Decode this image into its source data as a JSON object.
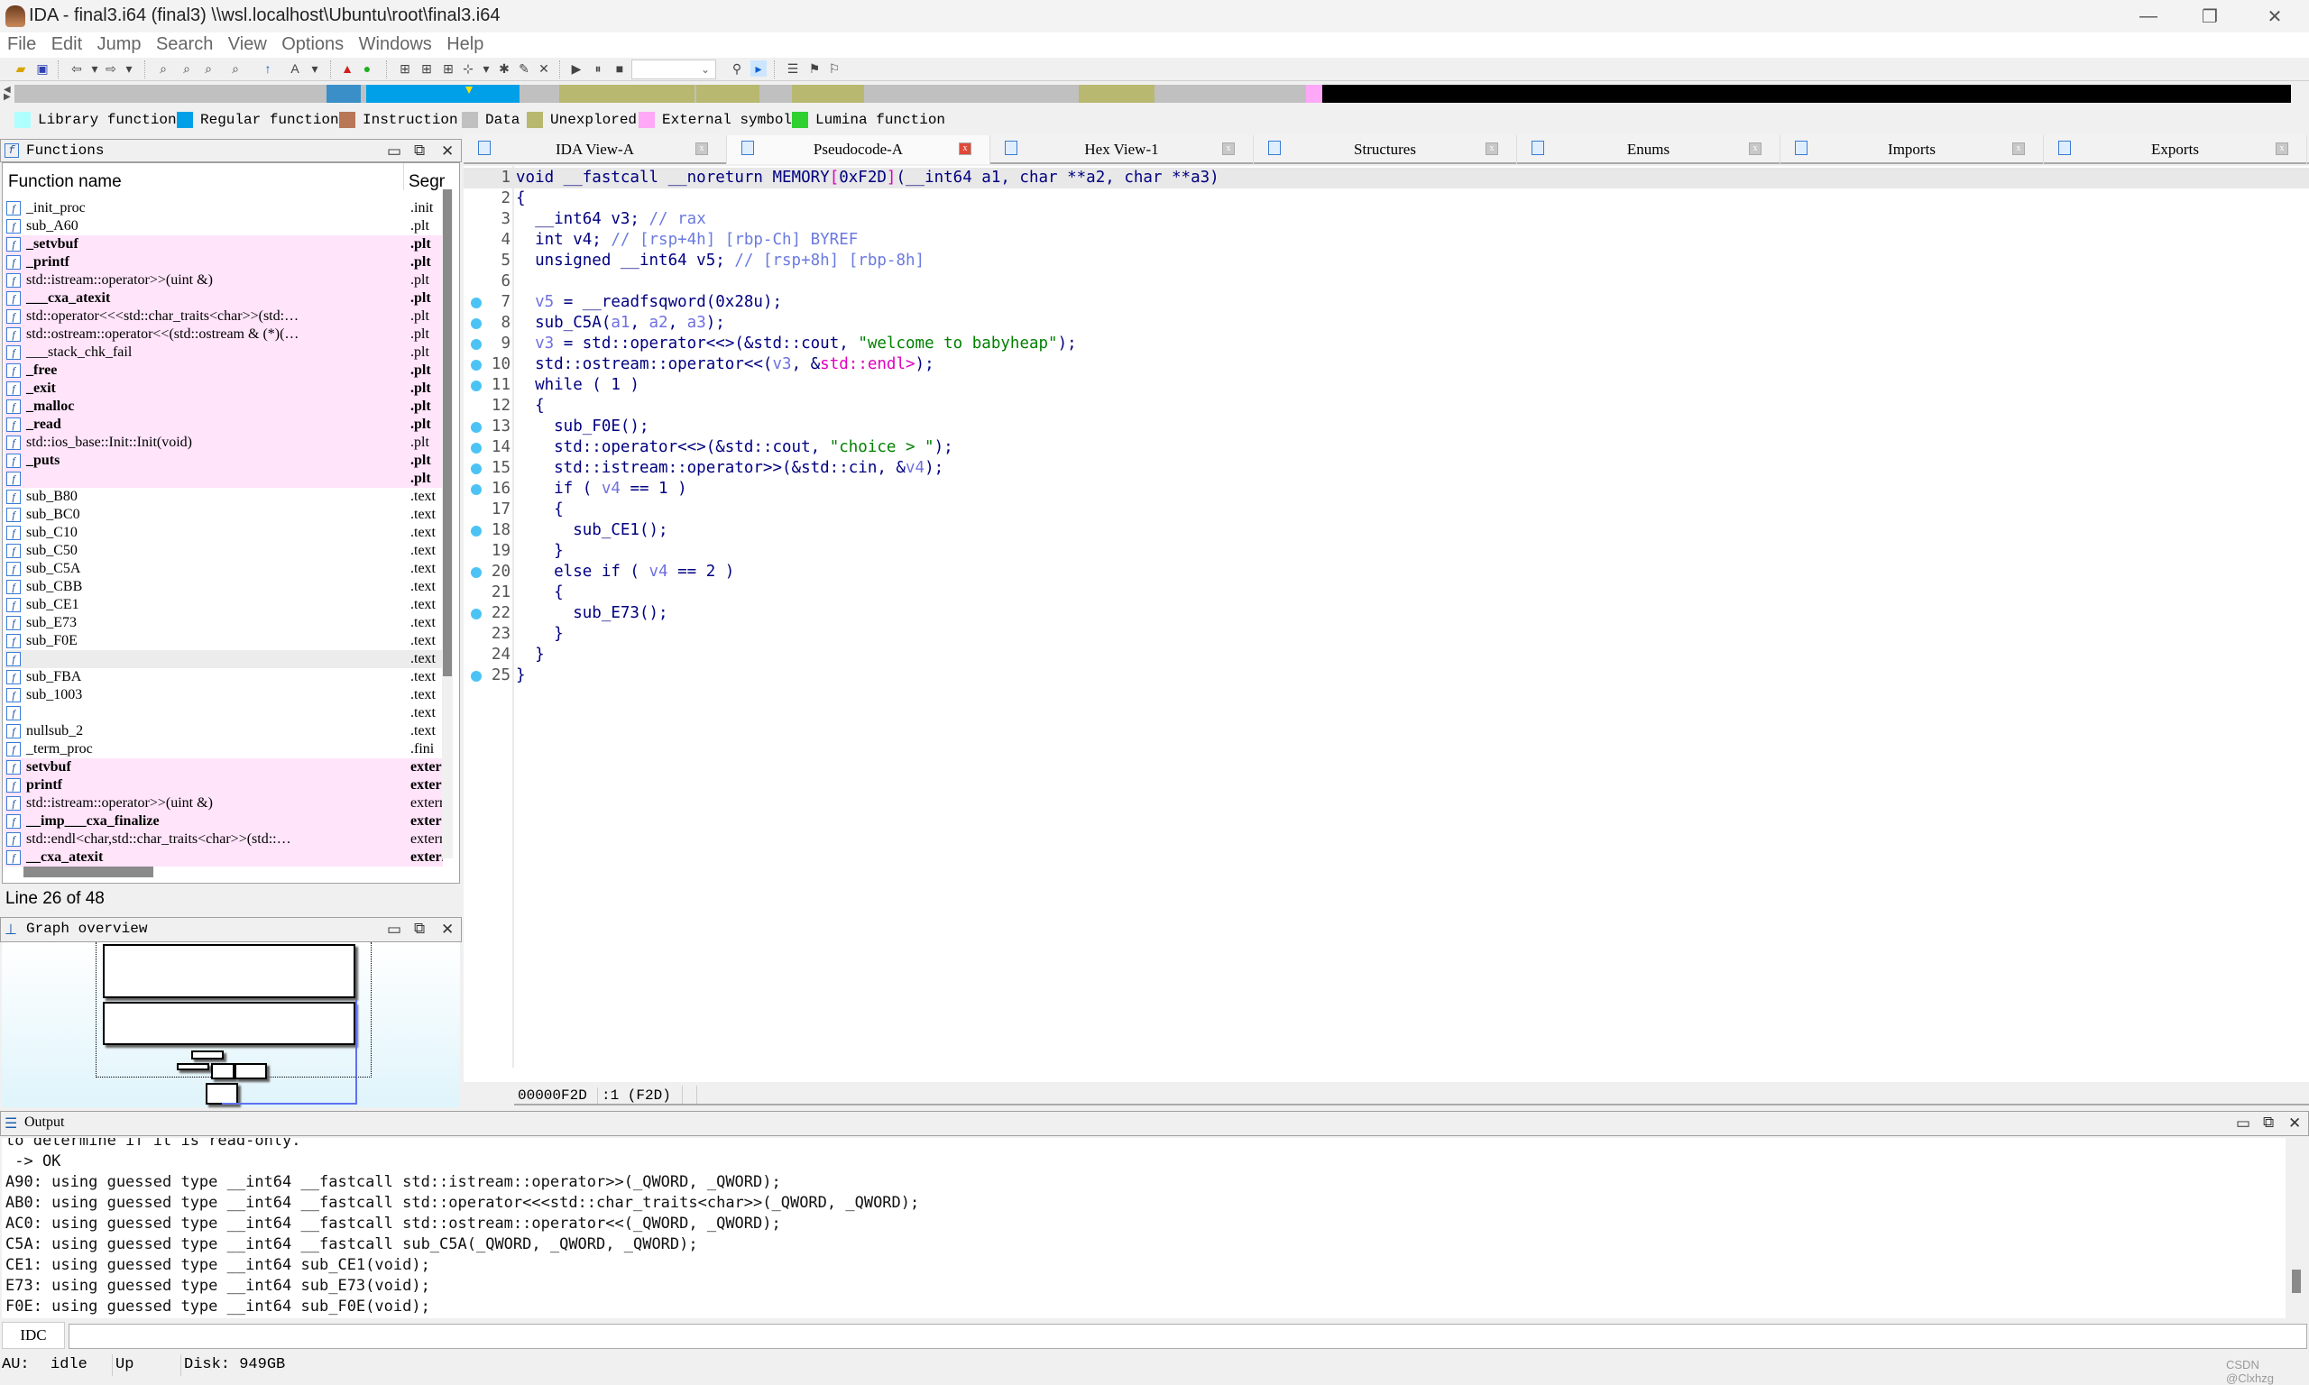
{
  "window": {
    "title": "IDA - final3.i64 (final3) \\\\wsl.localhost\\Ubuntu\\root\\final3.i64"
  },
  "menu": [
    "File",
    "Edit",
    "Jump",
    "Search",
    "View",
    "Options",
    "Windows",
    "Help"
  ],
  "legend": [
    {
      "label": "Library function",
      "color": "#b0ffff"
    },
    {
      "label": "Regular function",
      "color": "#00a0e8"
    },
    {
      "label": "Instruction",
      "color": "#b87858"
    },
    {
      "label": "Data",
      "color": "#c0c0c0"
    },
    {
      "label": "Unexplored",
      "color": "#b8b870"
    },
    {
      "label": "External symbol",
      "color": "#ffa8f8"
    },
    {
      "label": "Lumina function",
      "color": "#30d030"
    }
  ],
  "functions_panel": {
    "title": "Functions",
    "col_name": "Function name",
    "col_seg": "Segment",
    "rows": [
      {
        "name": "_init_proc",
        "seg": ".init",
        "style": "normal"
      },
      {
        "name": "sub_A60",
        "seg": ".plt",
        "style": "normal"
      },
      {
        "name": "_setvbuf",
        "seg": ".plt",
        "style": "pink-bold"
      },
      {
        "name": "_printf",
        "seg": ".plt",
        "style": "pink-bold"
      },
      {
        "name": "std::istream::operator>>(uint &)",
        "seg": ".plt",
        "style": "pink"
      },
      {
        "name": "___cxa_atexit",
        "seg": ".plt",
        "style": "pink-bold"
      },
      {
        "name": "std::operator<<<std::char_traits<char>>(std:…",
        "seg": ".plt",
        "style": "pink"
      },
      {
        "name": "std::ostream::operator<<(std::ostream & (*)(…",
        "seg": ".plt",
        "style": "pink"
      },
      {
        "name": "___stack_chk_fail",
        "seg": ".plt",
        "style": "pink"
      },
      {
        "name": "_free",
        "seg": ".plt",
        "style": "pink-bold"
      },
      {
        "name": "_exit",
        "seg": ".plt",
        "style": "pink-bold"
      },
      {
        "name": "_malloc",
        "seg": ".plt",
        "style": "pink-bold"
      },
      {
        "name": "_read",
        "seg": ".plt",
        "style": "pink-bold"
      },
      {
        "name": "std::ios_base::Init::Init(void)",
        "seg": ".plt",
        "style": "pink"
      },
      {
        "name": "_puts",
        "seg": ".plt",
        "style": "pink-bold"
      },
      {
        "name": "",
        "seg": ".plt",
        "style": "pink-bold"
      },
      {
        "name": "sub_B80",
        "seg": ".text",
        "style": "normal"
      },
      {
        "name": "sub_BC0",
        "seg": ".text",
        "style": "normal"
      },
      {
        "name": "sub_C10",
        "seg": ".text",
        "style": "normal"
      },
      {
        "name": "sub_C50",
        "seg": ".text",
        "style": "normal"
      },
      {
        "name": "sub_C5A",
        "seg": ".text",
        "style": "normal"
      },
      {
        "name": "sub_CBB",
        "seg": ".text",
        "style": "normal"
      },
      {
        "name": "sub_CE1",
        "seg": ".text",
        "style": "normal"
      },
      {
        "name": "sub_E73",
        "seg": ".text",
        "style": "normal"
      },
      {
        "name": "sub_F0E",
        "seg": ".text",
        "style": "normal"
      },
      {
        "name": "",
        "seg": ".text",
        "style": "selected"
      },
      {
        "name": "sub_FBA",
        "seg": ".text",
        "style": "normal"
      },
      {
        "name": "sub_1003",
        "seg": ".text",
        "style": "normal"
      },
      {
        "name": "",
        "seg": ".text",
        "style": "normal"
      },
      {
        "name": "nullsub_2",
        "seg": ".text",
        "style": "normal"
      },
      {
        "name": "_term_proc",
        "seg": ".fini",
        "style": "normal"
      },
      {
        "name": "setvbuf",
        "seg": "extern",
        "style": "pink-bold"
      },
      {
        "name": "printf",
        "seg": "extern",
        "style": "pink-bold"
      },
      {
        "name": "std::istream::operator>>(uint &)",
        "seg": "extern",
        "style": "pink"
      },
      {
        "name": "__imp___cxa_finalize",
        "seg": "extern",
        "style": "pink-bold"
      },
      {
        "name": "std::endl<char,std::char_traits<char>>(std::…",
        "seg": "extern",
        "style": "pink"
      },
      {
        "name": "__cxa_atexit",
        "seg": "extern",
        "style": "pink-bold"
      }
    ],
    "line_status": "Line 26 of 48"
  },
  "graph_overview": {
    "title": "Graph overview"
  },
  "tabs": [
    {
      "label": "IDA View-A",
      "active": false
    },
    {
      "label": "Pseudocode-A",
      "active": true
    },
    {
      "label": "Hex View-1",
      "active": false
    },
    {
      "label": "Structures",
      "active": false
    },
    {
      "label": "Enums",
      "active": false
    },
    {
      "label": "Imports",
      "active": false
    },
    {
      "label": "Exports",
      "active": false
    }
  ],
  "pseudocode": {
    "lines": [
      {
        "n": "1",
        "dot": false,
        "html": "void __fastcall __noreturn MEMORY<span class=\"m\">[</span>0xF2D<span class=\"m\">]</span>(__int64 a1, char **a2, char **a3)"
      },
      {
        "n": "2",
        "dot": false,
        "html": "{"
      },
      {
        "n": "3",
        "dot": false,
        "html": "  __int64 v3; <span class=\"c\">// rax</span>"
      },
      {
        "n": "4",
        "dot": false,
        "html": "  int v4; <span class=\"c\">// [rsp+4h] [rbp-Ch] BYREF</span>"
      },
      {
        "n": "5",
        "dot": false,
        "html": "  unsigned __int64 v5; <span class=\"c\">// [rsp+8h] [rbp-8h]</span>"
      },
      {
        "n": "6",
        "dot": false,
        "html": ""
      },
      {
        "n": "7",
        "dot": true,
        "html": "  <span class=\"v\">v5</span> = __readfsqword(0x28u);"
      },
      {
        "n": "8",
        "dot": true,
        "html": "  sub_C5A(<span class=\"v\">a1</span>, <span class=\"v\">a2</span>, <span class=\"v\">a3</span>);"
      },
      {
        "n": "9",
        "dot": true,
        "html": "  <span class=\"v\">v3</span> = std::operator<<<std::char_traits<char>>(&std::cout, <span class=\"s\">\"welcome to babyheap\"</span>);"
      },
      {
        "n": "10",
        "dot": true,
        "html": "  std::ostream::operator<<(<span class=\"v\">v3</span>, &<span class=\"m\">std::endl<char,std::char_traits<char>></span>);"
      },
      {
        "n": "11",
        "dot": true,
        "html": "  while ( 1 )"
      },
      {
        "n": "12",
        "dot": false,
        "html": "  {"
      },
      {
        "n": "13",
        "dot": true,
        "html": "    sub_F0E();"
      },
      {
        "n": "14",
        "dot": true,
        "html": "    std::operator<<<std::char_traits<char>>(&std::cout, <span class=\"s\">\"choice > \"</span>);"
      },
      {
        "n": "15",
        "dot": true,
        "html": "    std::istream::operator>>(&std::cin, &<span class=\"v\">v4</span>);"
      },
      {
        "n": "16",
        "dot": true,
        "html": "    if ( <span class=\"v\">v4</span> == 1 )"
      },
      {
        "n": "17",
        "dot": false,
        "html": "    {"
      },
      {
        "n": "18",
        "dot": true,
        "html": "      sub_CE1();"
      },
      {
        "n": "19",
        "dot": false,
        "html": "    }"
      },
      {
        "n": "20",
        "dot": true,
        "html": "    else if ( <span class=\"v\">v4</span> == 2 )"
      },
      {
        "n": "21",
        "dot": false,
        "html": "    {"
      },
      {
        "n": "22",
        "dot": true,
        "html": "      sub_E73();"
      },
      {
        "n": "23",
        "dot": false,
        "html": "    }"
      },
      {
        "n": "24",
        "dot": false,
        "html": "  }"
      },
      {
        "n": "25",
        "dot": true,
        "html": "}"
      }
    ],
    "status_addr": "00000F2D",
    "status_pos": ":1 (F2D)"
  },
  "output": {
    "title": "Output",
    "lines": [
      "to determine if it is read-only.",
      " -> OK",
      "A90: using guessed type __int64 __fastcall std::istream::operator>>(_QWORD, _QWORD);",
      "AB0: using guessed type __int64 __fastcall std::operator<<<std::char_traits<char>>(_QWORD, _QWORD);",
      "AC0: using guessed type __int64 __fastcall std::ostream::operator<<(_QWORD, _QWORD);",
      "C5A: using guessed type __int64 __fastcall sub_C5A(_QWORD, _QWORD, _QWORD);",
      "CE1: using guessed type __int64 sub_CE1(void);",
      "E73: using guessed type __int64 sub_E73(void);",
      "F0E: using guessed type __int64 sub_F0E(void);"
    ],
    "idc_label": "IDC"
  },
  "status": {
    "au": "AU:",
    "state": "idle",
    "dir": "Up",
    "disk": "Disk: 949GB",
    "watermark": "CSDN @Clxhzg"
  }
}
